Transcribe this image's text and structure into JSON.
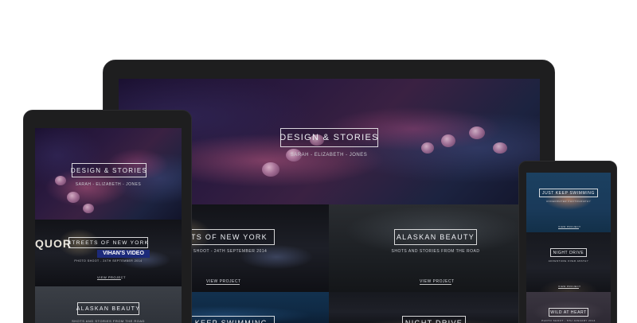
{
  "hero": {
    "title": "DESIGN & STORIES",
    "subtitle": "SARAH - ELIZABETH - JONES"
  },
  "projects": {
    "streets": {
      "title": "STREETS OF NEW YORK",
      "laptop_subtitle": "PHOTO SHOOT - 24TH SEPTEMBER 2014",
      "tablet_subtitle": "PHOTO SHOOT - 24TH SEPTEMBER 2014",
      "store_sign": "VIHAN'S VIDEO",
      "store_letters": "QUOR"
    },
    "alaska": {
      "title": "ALASKAN BEAUTY",
      "subtitle": "SHOTS AND STORIES FROM THE ROAD"
    },
    "swimming": {
      "title": "JUST KEEP SWIMMING",
      "subtitle": "UNDERWATER PHOTOGRAPHY"
    },
    "night": {
      "title": "NIGHT DRIVE",
      "subtitle": "ADVENTURE OVER APATHY"
    },
    "wild": {
      "title": "WILD AT HEART",
      "subtitle": "PHOTO SHOOT - 5TH JANUARY 2014"
    }
  },
  "labels": {
    "view_project": "VIEW PROJECT"
  },
  "devices": {
    "laptop": {
      "visible_titles": {
        "streets": "EETS OF NEW YORK",
        "streets_sub": "TO SHOOT - 24TH SEPTEMBER 2014",
        "swimming": "T KEEP SWIMMING",
        "night": "NIGHT DRIVE"
      }
    },
    "tablet": {
      "visible_titles": {
        "streets": "STREETS OF NEW YORK",
        "streets_sub": "PHOTO SHOOT - 24TH SEPTEMBER 2014"
      }
    },
    "phone": {
      "visible_titles": {
        "swimming": "JUST KEEP SWIMMING",
        "swimming_sub": "UNDERWATER PHOTOGRAPHY",
        "night": "NIGHT DRIVE",
        "night_sub": "ADVENTURE OVER APATHY",
        "wild": "WILD AT HEART",
        "wild_sub": "PHOTO SHOOT - 5TH JANUARY 2014"
      }
    }
  }
}
